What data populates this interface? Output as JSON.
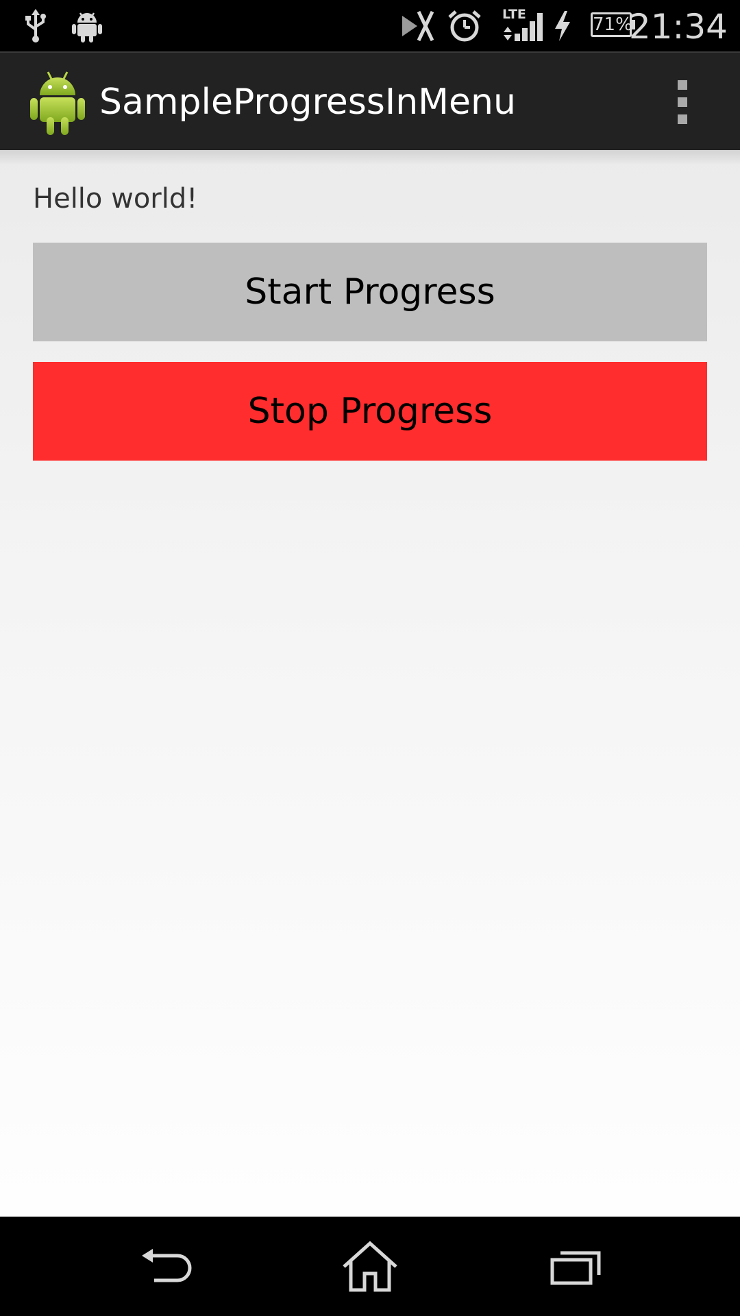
{
  "status_bar": {
    "time": "21:34",
    "battery_percent": "71%",
    "network_type": "LTE",
    "icons": [
      "usb-icon",
      "android-debug-icon",
      "nfc-off-icon",
      "alarm-icon",
      "signal-icon",
      "charging-icon",
      "battery-icon"
    ]
  },
  "action_bar": {
    "title": "SampleProgressInMenu",
    "app_icon": "android-robot-icon",
    "overflow_icon": "overflow-menu-icon"
  },
  "content": {
    "hello_text": "Hello world!",
    "start_button_label": "Start Progress",
    "stop_button_label": "Stop Progress"
  },
  "colors": {
    "start_button_bg": "#bebebe",
    "stop_button_bg": "#ff2d2d",
    "action_bar_bg": "#222222",
    "android_green": "#a4c639"
  },
  "nav_bar": {
    "icons": [
      "back-icon",
      "home-icon",
      "recent-apps-icon"
    ]
  }
}
